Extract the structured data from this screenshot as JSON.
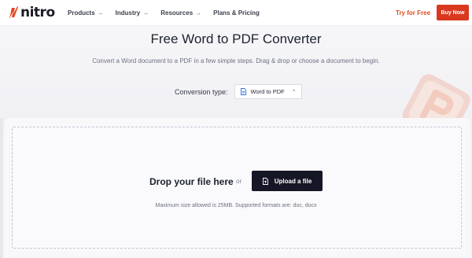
{
  "header": {
    "logo_text": "nitro",
    "nav": [
      {
        "label": "Products",
        "arrow": "→"
      },
      {
        "label": "Industry",
        "arrow": "→"
      },
      {
        "label": "Resources",
        "arrow": "→"
      },
      {
        "label": "Plans & Pricing",
        "arrow": ""
      }
    ],
    "try_free": "Try for Free",
    "buy_now": "Buy Now"
  },
  "hero": {
    "title": "Free Word to PDF Converter",
    "subtitle": "Convert a Word document to a PDF in a few simple steps. Drag & drop or choose a document to begin.",
    "conversion_label": "Conversion type:",
    "conversion_value": "Word to PDF"
  },
  "dropzone": {
    "drop_label": "Drop your file here",
    "or_text": "or",
    "upload_label": "Upload a file",
    "hint": "Maximum size allowed is 25MB. Supported formats are: doc, docx"
  },
  "colors": {
    "brand": "#d9381e",
    "accent_text": "#e04a1d",
    "upload_button": "#151726"
  }
}
